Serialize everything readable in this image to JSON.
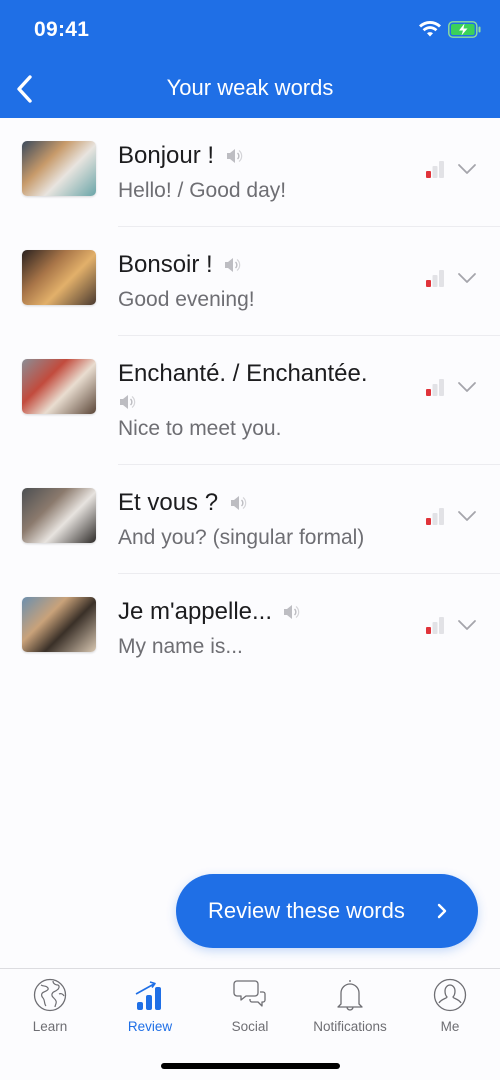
{
  "status_bar": {
    "time": "09:41",
    "icons": [
      "wifi-icon",
      "battery-charging-icon"
    ]
  },
  "nav": {
    "back_icon": "chevron-left-icon",
    "title": "Your weak words"
  },
  "words": [
    {
      "phrase": "Bonjour !",
      "translation": "Hello! / Good day!",
      "speaker_inline": true,
      "strength": {
        "level": 1,
        "max": 3,
        "color": "#e0333a"
      },
      "thumb_colors": [
        "#3b4a5c",
        "#c79a6a",
        "#e8e4df",
        "#6aa5a8"
      ]
    },
    {
      "phrase": "Bonsoir !",
      "translation": "Good evening!",
      "speaker_inline": true,
      "strength": {
        "level": 1,
        "max": 3,
        "color": "#e0333a"
      },
      "thumb_colors": [
        "#2a2220",
        "#a87548",
        "#e2b06a",
        "#4a3a30"
      ]
    },
    {
      "phrase": "Enchanté. / Enchantée.",
      "translation": "Nice to meet you.",
      "speaker_inline": false,
      "strength": {
        "level": 1,
        "max": 3,
        "color": "#e0333a"
      },
      "thumb_colors": [
        "#8a8e96",
        "#c24b3d",
        "#e9ddd0",
        "#5b4638"
      ]
    },
    {
      "phrase": "Et vous ?",
      "translation": "And you? (singular formal)",
      "speaker_inline": true,
      "strength": {
        "level": 1,
        "max": 3,
        "color": "#e0333a"
      },
      "thumb_colors": [
        "#4c4f52",
        "#8b7a6d",
        "#e7e3df",
        "#2e2b29"
      ]
    },
    {
      "phrase": "Je m'appelle...",
      "translation": "My name is...",
      "speaker_inline": true,
      "strength": {
        "level": 1,
        "max": 3,
        "color": "#e0333a"
      },
      "thumb_colors": [
        "#6b8fae",
        "#c9a27a",
        "#3a3028",
        "#d8c7b2"
      ]
    }
  ],
  "review_button": {
    "label": "Review these words",
    "icon": "chevron-right-icon"
  },
  "tab_bar": {
    "active": "review",
    "tabs": [
      {
        "id": "learn",
        "label": "Learn",
        "icon": "globe-icon"
      },
      {
        "id": "review",
        "label": "Review",
        "icon": "chart-up-icon"
      },
      {
        "id": "social",
        "label": "Social",
        "icon": "chat-bubbles-icon"
      },
      {
        "id": "notifications",
        "label": "Notifications",
        "icon": "bell-icon"
      },
      {
        "id": "me",
        "label": "Me",
        "icon": "person-icon"
      }
    ]
  },
  "colors": {
    "brand": "#1f6fe6",
    "weak": "#e0333a",
    "text_primary": "#1c1c1e",
    "text_secondary": "#6e6e73"
  }
}
